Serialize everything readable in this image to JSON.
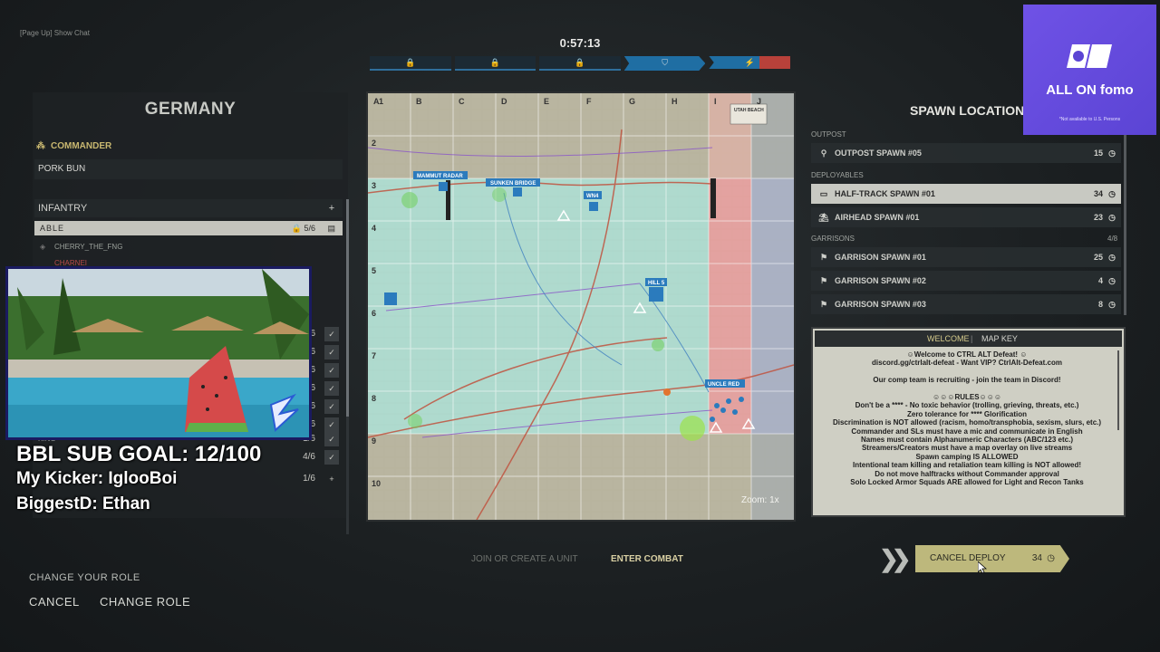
{
  "top": {
    "chat_hint": "[Page Up] Show Chat",
    "timer": "0:57:13",
    "segments": [
      {
        "icon": "lock-icon",
        "glyph": "🔒",
        "state": "neutral"
      },
      {
        "icon": "lock-icon",
        "glyph": "🔒",
        "state": "neutral"
      },
      {
        "icon": "lock-icon",
        "glyph": "🔒",
        "state": "neutral"
      },
      {
        "icon": "shield-icon",
        "glyph": "⛉",
        "state": "allied"
      },
      {
        "icon": "lightning-icon",
        "glyph": "⚡",
        "state": "contested"
      }
    ]
  },
  "left_panel": {
    "faction": "GERMANY",
    "commander_label": "COMMANDER",
    "commander_name": "PORK BUN",
    "infantry_label": "INFANTRY",
    "infantry_add": "+",
    "squad_able": {
      "name": "ABLE",
      "count": "5/6"
    },
    "members": [
      "CHERRY_THE_FNG",
      "CHARNEI"
    ],
    "squads": [
      {
        "count": "6"
      },
      {
        "count": "6"
      },
      {
        "count": "6"
      },
      {
        "count": "6"
      },
      {
        "count": "6"
      },
      {
        "count": "6"
      },
      {
        "name": "KING",
        "count": "1/6"
      },
      {
        "count": "4/6"
      },
      {
        "count": "1/6"
      }
    ]
  },
  "overlay": {
    "sub_goal": "BBL SUB GOAL: 12/100",
    "kicker": "My Kicker: IglooBoi",
    "biggest": "BiggestD: Ethan"
  },
  "bottom_left": {
    "hint": "CHANGE YOUR ROLE",
    "cancel": "CANCEL",
    "change_role": "CHANGE ROLE"
  },
  "map": {
    "columns": [
      "A",
      "B",
      "C",
      "D",
      "E",
      "F",
      "G",
      "H",
      "I",
      "J"
    ],
    "rows": [
      "1",
      "2",
      "3",
      "4",
      "5",
      "6",
      "7",
      "8",
      "9",
      "10"
    ],
    "zoom": "Zoom: 1x",
    "labels": {
      "mammut": "MAMMUT RADAR",
      "sunken": "SUNKEN BRIDGE",
      "wn4": "WN4",
      "hill": "HILL 5",
      "uncle": "UNCLE RED",
      "utah": "UTAH BEACH"
    },
    "colors": {
      "enemy_zone": "#e79a9a",
      "neutral_zone": "#b7b9cc",
      "allied_fill": "#a9dcd2",
      "blue_marker": "#2b7bbd"
    }
  },
  "bottom_center": {
    "join_unit": "JOIN OR CREATE A UNIT",
    "enter_combat": "ENTER COMBAT"
  },
  "spawns": {
    "title": "SPAWN LOCATIONS",
    "outpost_label": "OUTPOST",
    "deployables_label": "DEPLOYABLES",
    "garrisons_label": "GARRISONS",
    "garrison_count": "4/8",
    "items": [
      {
        "label": "OUTPOST SPAWN #05",
        "count": "15",
        "icon": "outpost-icon"
      },
      {
        "label": "HALF-TRACK SPAWN #01",
        "count": "34",
        "icon": "halftrack-icon"
      },
      {
        "label": "AIRHEAD SPAWN #01",
        "count": "23",
        "icon": "airhead-icon"
      },
      {
        "label": "GARRISON SPAWN #01",
        "count": "25",
        "icon": "garrison-icon"
      },
      {
        "label": "GARRISON SPAWN #02",
        "count": "4",
        "icon": "garrison-icon"
      },
      {
        "label": "GARRISON SPAWN #03",
        "count": "8",
        "icon": "garrison-icon"
      }
    ]
  },
  "welcome": {
    "tab_welcome": "WELCOME",
    "tab_mapkey": "MAP KEY",
    "lines": [
      "☺Welcome to CTRL ALT Defeat! ☺",
      "discord.gg/ctrlalt-defeat - Want VIP? CtrlAlt-Defeat.com",
      "",
      "Our comp team is recruiting - join the team in Discord!",
      "",
      "☺☺☺RULES☺☺☺",
      "Don't be a **** - No toxic behavior (trolling, grieving, threats, etc.)",
      "Zero tolerance for **** Glorification",
      "Discrimination is NOT allowed (racism, homo/transphobia, sexism, slurs, etc.)",
      "Commander and SLs must have a mic and communicate in English",
      "Names must contain Alphanumeric Characters (ABC/123 etc.)",
      "Streamers/Creators must have a map overlay on live streams",
      "Spawn camping IS ALLOWED",
      "Intentional team killing and retaliation team killing is NOT allowed!",
      "Do not move halftracks without Commander approval",
      "Solo Locked Armor Squads ARE allowed for Light and Recon Tanks"
    ]
  },
  "deploy": {
    "label": "CANCEL DEPLOY",
    "count": "34"
  },
  "ad": {
    "brand": "ALL ON fomo",
    "fine": "*Not available to U.S. Persons"
  }
}
